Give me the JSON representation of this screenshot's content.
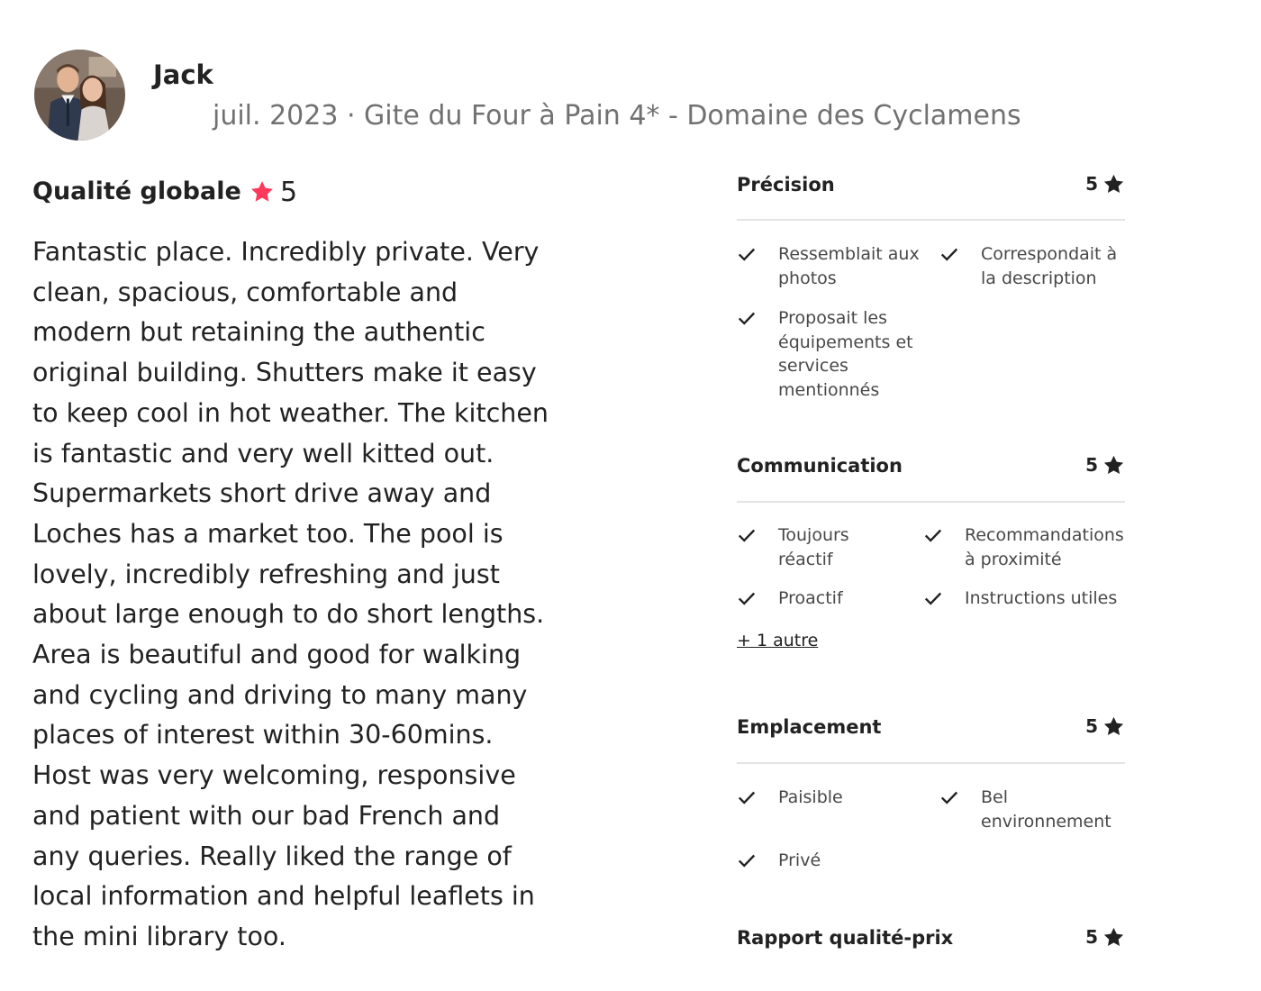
{
  "reviewer": {
    "name": "Jack",
    "avatar_icon": "avatar-photo",
    "stay_info": "juil. 2023 · Gite du Four à Pain 4* - Domaine des Cyclamens"
  },
  "overall": {
    "title": "Qualité globale",
    "score": "5",
    "star_color": "#FF385C"
  },
  "review_lines": [
    "Fantastic place. Incredibly private. Very",
    "clean, spacious, comfortable and",
    "modern but retaining the authentic",
    "original building. Shutters make it easy",
    "to keep cool in hot weather. The kitchen",
    "is fantastic and very well kitted out.",
    "Supermarkets short drive away and",
    "Loches has a market too. The pool is",
    "lovely, incredibly refreshing and just",
    "about large enough to do short lengths.",
    "Area is beautiful and good for walking",
    "and cycling and driving to many many",
    "places of interest within 30-60mins.",
    "Host was very welcoming, responsive",
    "and patient with our bad French and",
    "any queries. Really liked the range of",
    "local information and helpful leaflets in",
    "the mini library too."
  ],
  "categories": [
    {
      "title": "Précision",
      "score": "5",
      "tags": [
        "Ressemblait aux photos",
        "Correspondait à la description",
        "Proposait les équipements et services mentionnés"
      ]
    },
    {
      "title": "Communication",
      "score": "5",
      "tags": [
        "Toujours réactif",
        "Recommandations à proximité",
        "Proactif",
        "Instructions utiles"
      ],
      "more_link": "+ 1 autre"
    },
    {
      "title": "Emplacement",
      "score": "5",
      "tags": [
        "Paisible",
        "Bel environnement",
        "Privé"
      ]
    },
    {
      "title": "Rapport qualité-prix",
      "score": "5",
      "tags": []
    }
  ]
}
